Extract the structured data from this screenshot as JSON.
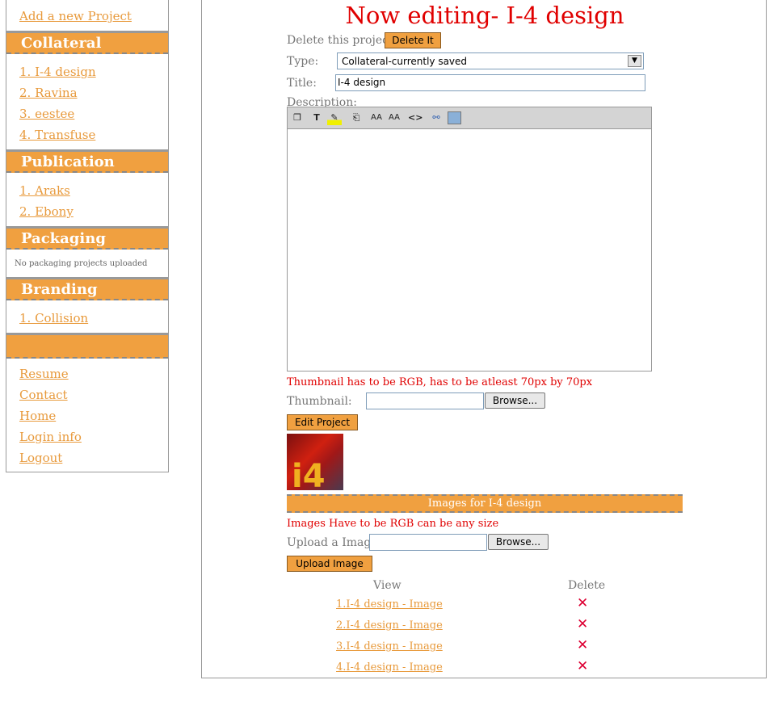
{
  "sidebar": {
    "add_project": "Add a new Project",
    "sections": [
      {
        "title": "Collateral",
        "items": [
          "1. I-4 design",
          "2. Ravina",
          "3. eestee",
          "4. Transfuse"
        ]
      },
      {
        "title": "Publication",
        "items": [
          "1. Araks",
          "2. Ebony"
        ]
      },
      {
        "title": "Packaging",
        "note": "No packaging projects uploaded"
      },
      {
        "title": "Branding",
        "items": [
          "1. Collision"
        ]
      },
      {
        "title": ""
      }
    ],
    "links": [
      "Resume",
      "Contact",
      "Home",
      "Login info",
      "Logout"
    ]
  },
  "main": {
    "title": "Now editing- I-4 design",
    "delete_prompt": "Delete this project?",
    "delete_button": "Delete It",
    "type_label": "Type:",
    "type_value": "Collateral-currently saved",
    "title_label": "Title:",
    "title_value": "I-4 design",
    "description_label": "Description:",
    "thumbnail_note": "Thumbnail has to be RGB, has to be atleast 70px by 70px",
    "thumbnail_label": "Thumbnail:",
    "browse_label": "Browse...",
    "edit_button": "Edit Project",
    "images_header": "Images for I-4 design",
    "images_note": "Images Have to be RGB can be any size",
    "upload_label": "Upload a Image:",
    "upload_button": "Upload Image",
    "col_view": "View",
    "col_delete": "Delete",
    "images": [
      "1.I-4 design - Image",
      "2.I-4 design - Image",
      "3.I-4 design - Image",
      "4.I-4 design - Image"
    ],
    "thumbnail_text": "i4"
  },
  "colors": {
    "accent": "#f0a040",
    "title_red": "#e00000",
    "delete_x": "#dd0033"
  }
}
